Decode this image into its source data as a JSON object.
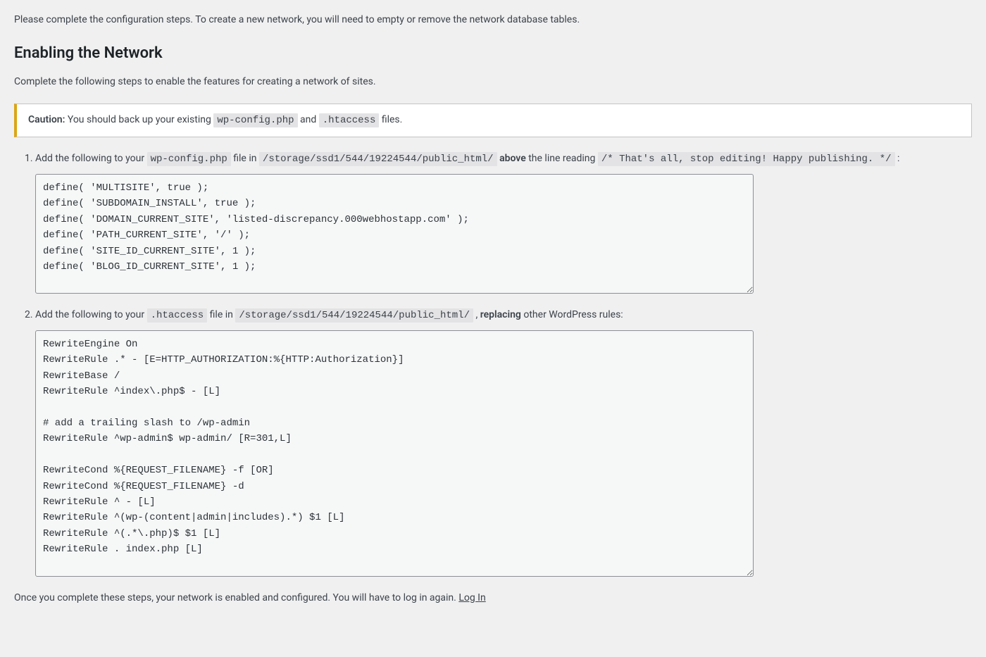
{
  "intro": "Please complete the configuration steps. To create a new network, you will need to empty or remove the network database tables.",
  "heading": "Enabling the Network",
  "subheading": "Complete the following steps to enable the features for creating a network of sites.",
  "notice": {
    "caution_label": "Caution:",
    "text_before": " You should back up your existing ",
    "file1": "wp-config.php",
    "and": " and ",
    "file2": ".htaccess",
    "text_after": " files."
  },
  "step1": {
    "prefix": "Add the following to your ",
    "file": "wp-config.php",
    "mid1": " file in ",
    "path": "/storage/ssd1/544/19224544/public_html/",
    "mid2": " ",
    "above": "above",
    "mid3": " the line reading ",
    "stop_line": "/* That's all, stop editing! Happy publishing. */",
    "suffix": " :",
    "code": "define( 'MULTISITE', true );\ndefine( 'SUBDOMAIN_INSTALL', true );\ndefine( 'DOMAIN_CURRENT_SITE', 'listed-discrepancy.000webhostapp.com' );\ndefine( 'PATH_CURRENT_SITE', '/' );\ndefine( 'SITE_ID_CURRENT_SITE', 1 );\ndefine( 'BLOG_ID_CURRENT_SITE', 1 );"
  },
  "step2": {
    "prefix": "Add the following to your ",
    "file": ".htaccess",
    "mid1": " file in ",
    "path": "/storage/ssd1/544/19224544/public_html/",
    "mid2": " , ",
    "replacing": "replacing",
    "suffix": " other WordPress rules:",
    "code": "RewriteEngine On\nRewriteRule .* - [E=HTTP_AUTHORIZATION:%{HTTP:Authorization}]\nRewriteBase /\nRewriteRule ^index\\.php$ - [L]\n\n# add a trailing slash to /wp-admin\nRewriteRule ^wp-admin$ wp-admin/ [R=301,L]\n\nRewriteCond %{REQUEST_FILENAME} -f [OR]\nRewriteCond %{REQUEST_FILENAME} -d\nRewriteRule ^ - [L]\nRewriteRule ^(wp-(content|admin|includes).*) $1 [L]\nRewriteRule ^(.*\\.php)$ $1 [L]\nRewriteRule . index.php [L]"
  },
  "footer": {
    "text": "Once you complete these steps, your network is enabled and configured. You will have to log in again. ",
    "login_label": "Log In"
  }
}
